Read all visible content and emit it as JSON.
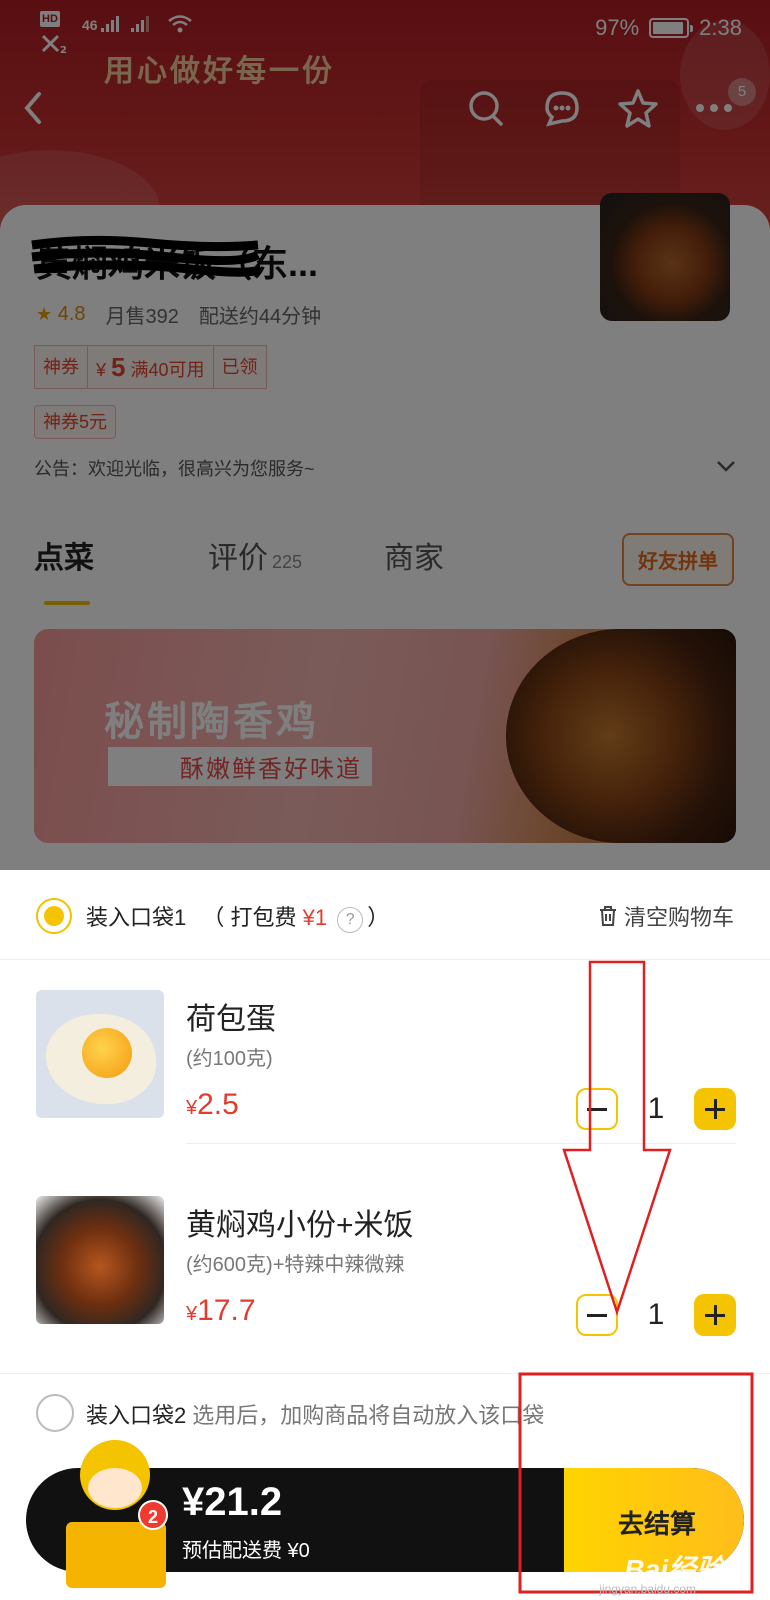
{
  "status_bar": {
    "left_top": "HD",
    "network": "46",
    "battery": "97%",
    "time": "2:38"
  },
  "hero": {
    "slogan": "用心做好每一份",
    "message_badge": "5"
  },
  "store": {
    "name": "黄焖鸡米饭（东...",
    "rating": "4.8",
    "monthly_sales": "月售392",
    "delivery_time": "配送约44分钟",
    "coupon_tag": "神券",
    "coupon_currency": "¥",
    "coupon_value": "5",
    "coupon_condition": "满40可用",
    "coupon_status": "已领",
    "coupon2": "神券5元",
    "notice": "公告：欢迎光临，很高兴为您服务~"
  },
  "tabs": {
    "order": "点菜",
    "reviews": "评价",
    "reviews_count": "225",
    "merchant": "商家",
    "friends_button": "好友拼单"
  },
  "banner": {
    "title": "秘制陶香鸡",
    "subtitle": "酥嫩鲜香好味道"
  },
  "cart": {
    "bag1_label": "装入口袋1",
    "bag1_fee_prefix": "（ 打包费 ",
    "bag1_fee": "¥1",
    "bag1_fee_suffix": "）",
    "help": "?",
    "clear_cart": "清空购物车",
    "items": [
      {
        "title": "荷包蛋",
        "spec": "(约100克)",
        "currency": "¥",
        "price": "2.5",
        "qty": "1"
      },
      {
        "title": "黄焖鸡小份+米饭",
        "spec": "(约600克)+特辣中辣微辣",
        "currency": "¥",
        "price": "17.7",
        "qty": "1"
      }
    ],
    "bag2_label": "装入口袋2",
    "bag2_hint": "选用后，加购商品将自动放入该口袋"
  },
  "checkout": {
    "total": "¥21.2",
    "delivery_fee": "预估配送费 ¥0",
    "cart_count": "2",
    "button": "去结算"
  },
  "watermark": {
    "text": "Bai经验",
    "url": "jingyan.baidu.com"
  },
  "colors": {
    "accent": "#f5c400",
    "price": "#e23c2f",
    "annotation": "#e02020"
  }
}
